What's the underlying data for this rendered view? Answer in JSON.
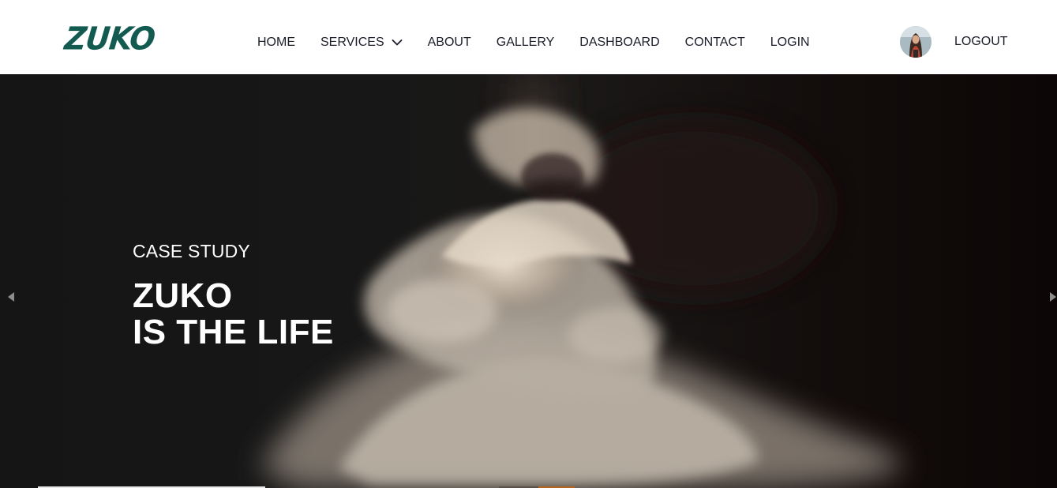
{
  "brand": {
    "logo_text": "ZUKO",
    "color": "#135b50"
  },
  "nav": {
    "items": [
      {
        "label": "HOME"
      },
      {
        "label": "SERVICES",
        "has_dropdown": true
      },
      {
        "label": "ABOUT"
      },
      {
        "label": "GALLERY"
      },
      {
        "label": "DASHBOARD"
      },
      {
        "label": "CONTACT"
      },
      {
        "label": "LOGIN"
      }
    ],
    "text_color": "#1b1d2a"
  },
  "user": {
    "avatar_icon": "user-avatar",
    "logout_label": "LOGOUT"
  },
  "hero": {
    "eyebrow": "CASE STUDY",
    "headline_line1": "ZUKO",
    "headline_line2": "IS THE LIFE",
    "prev_icon": "triangle-left-icon",
    "next_icon": "triangle-right-icon"
  }
}
